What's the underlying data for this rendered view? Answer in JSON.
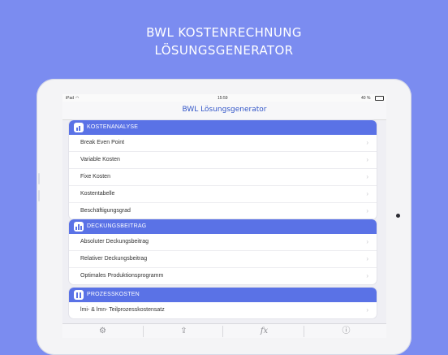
{
  "promo": {
    "line1": "BWL KOSTENRECHNUNG",
    "line2": "LÖSUNGSGENERATOR"
  },
  "status_bar": {
    "carrier": "iPad",
    "wifi_icon": "wifi-icon",
    "time": "15:59",
    "battery": "40 %"
  },
  "navbar": {
    "title": "BWL Lösungsgenerator"
  },
  "sections": [
    {
      "title": "KOSTENANALYSE",
      "icon": "document-chart-icon",
      "items": [
        "Break Even Point",
        "Variable Kosten",
        "Fixe Kosten",
        "Kostentabelle",
        "Beschäftigungsgrad"
      ]
    },
    {
      "title": "DECKUNGSBEITRAG",
      "icon": "bar-chart-icon",
      "items": [
        "Absoluter Deckungsbeitrag",
        "Relativer Deckungsbeitrag",
        "Optimales Produktionsprogramm"
      ]
    },
    {
      "title": "PROZESSKOSTEN",
      "icon": "process-icon",
      "items": [
        "lmi- & lmn- Teilprozesskostensatz"
      ]
    }
  ],
  "tabbar": {
    "tabs": [
      {
        "icon": "gear-icon",
        "glyph": "⚙"
      },
      {
        "icon": "share-icon",
        "glyph": "⇪"
      },
      {
        "icon": "function-icon",
        "glyph": "fx"
      },
      {
        "icon": "info-icon",
        "glyph": "ⓘ"
      }
    ]
  },
  "colors": {
    "background": "#7b8cf0",
    "section_header": "#5a72e6",
    "nav_title": "#3457c8"
  }
}
